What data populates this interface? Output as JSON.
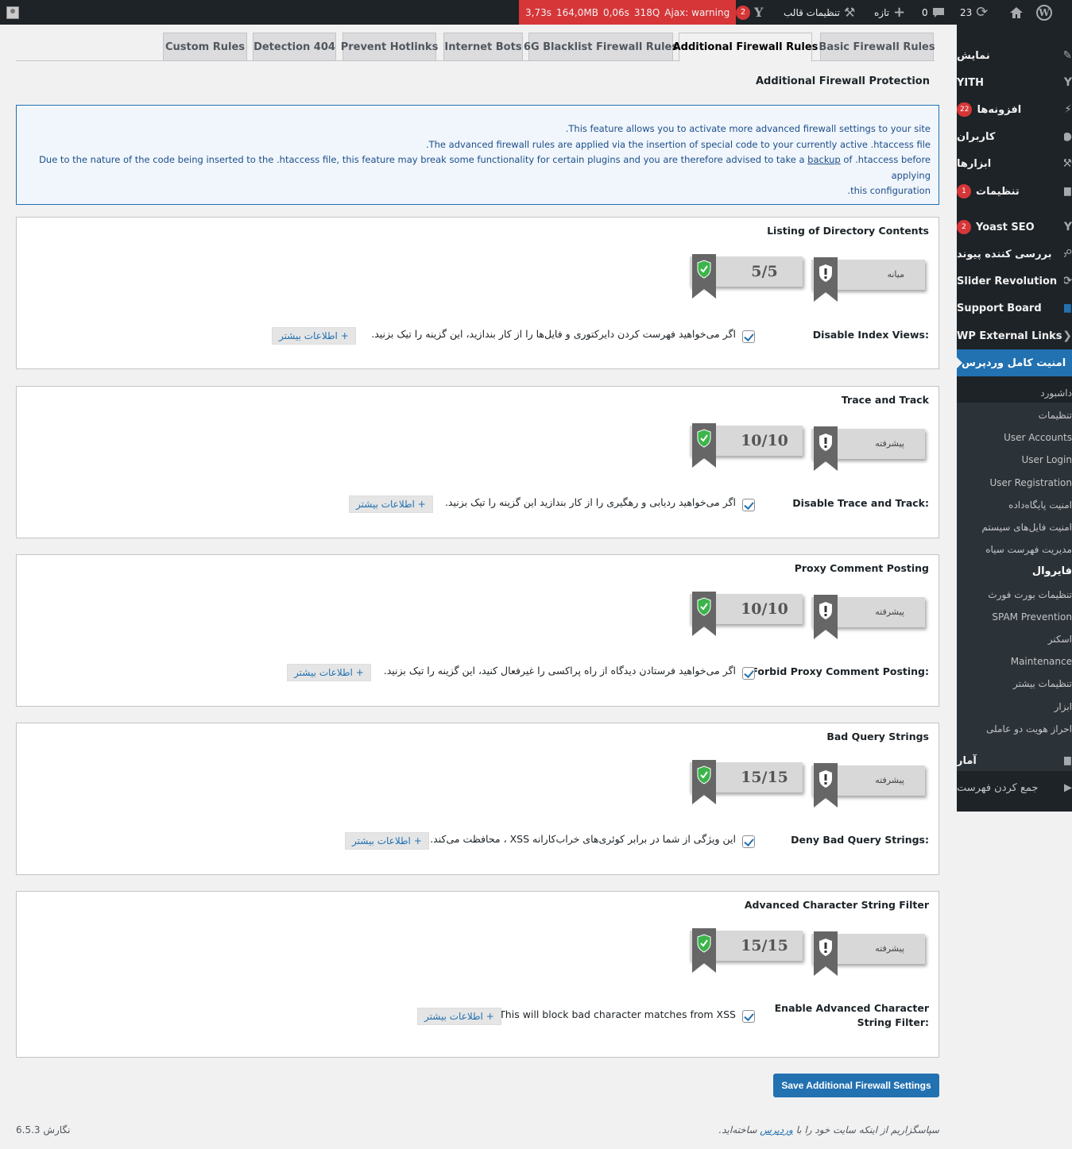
{
  "adminbar": {
    "avatar_icon": "avatar-icon",
    "debug": {
      "time": "3,73s",
      "memory": "164,0MB",
      "query_time": "0,06s",
      "queries": "318Q",
      "ajax": "Ajax: warning"
    },
    "yoast_count": "2",
    "theme_settings": "تنظیمات قالب",
    "new_label": "تازه",
    "comments_count": "0",
    "updates_count": "23"
  },
  "sidebar": {
    "items": [
      {
        "label": "نمایش",
        "icon": "appearance-icon"
      },
      {
        "label": "YITH",
        "icon": "yith-icon"
      },
      {
        "label": "افزونه‌ها",
        "icon": "plugins-icon",
        "badge": "22"
      },
      {
        "label": "کاربران",
        "icon": "users-icon"
      },
      {
        "label": "ابزارها",
        "icon": "tools-icon"
      },
      {
        "label": "تنظیمات",
        "icon": "settings-icon",
        "badge": "1"
      },
      {
        "label": "Yoast SEO",
        "icon": "yoast-icon",
        "badge": "2"
      },
      {
        "label": "بررسی کننده پیوند",
        "icon": "link-checker-icon"
      },
      {
        "label": "Slider Revolution",
        "icon": "slider-icon"
      },
      {
        "label": "Support Board",
        "icon": "support-icon"
      },
      {
        "label": "WP External Links",
        "icon": "external-links-icon"
      },
      {
        "label": "امنیت کامل وردپرس",
        "icon": "shield-icon"
      },
      {
        "label": "آمار",
        "icon": "stats-icon"
      },
      {
        "label": "جمع کردن فهرست",
        "icon": "collapse-icon"
      }
    ],
    "submenu": [
      "داشبورد",
      "تنظیمات",
      "User Accounts",
      "User Login",
      "User Registration",
      "امنیت پایگاه‌داده",
      "امنیت فایل‌های سیستم",
      "مدیریت فهرست سیاه",
      "فایروال",
      "تنظیمات بورت فورث",
      "SPAM Prevention",
      "اسکنر",
      "Maintenance",
      "تنظیمات بیشتر",
      "ابزار",
      "احراز هویت دو عاملی"
    ]
  },
  "tabs": [
    "Custom Rules",
    "Detection 404",
    "Prevent Hotlinks",
    "Internet Bots",
    "6G Blacklist Firewall Rules",
    "Additional Firewall Rules",
    "Basic Firewall Rules"
  ],
  "active_tab": "Additional Firewall Rules",
  "page_heading": "Additional Firewall Protection",
  "info": {
    "line1": ".This feature allows you to activate more advanced firewall settings to your site",
    "line2": ".The advanced firewall rules are applied via the insertion of special code to your currently active .htaccess file",
    "line3_pre": "Due to the nature of the code being inserted to the .htaccess file, this feature may break some functionality for certain plugins and you are therefore advised to take a",
    "line3_link": "backup",
    "line3_post": "of .htaccess before applying",
    "line4": ".this configuration"
  },
  "sections": [
    {
      "title": "Listing of Directory Contents",
      "level": "میانه",
      "score": "5/5",
      "field_label": "Disable Index Views:",
      "description": "اگر می‌خواهید فهرست کردن دایرکتوری و فایل‌ها را از کار بندازید، این گزینه را تیک بزنید.",
      "more": "+ اطلاعات بیشتر"
    },
    {
      "title": "Trace and Track",
      "level": "پیشرفته",
      "score": "10/10",
      "field_label": "Disable Trace and Track:",
      "description": "اگر می‌خواهید ردیابی و رهگیری را از کار بندازید این گزینه را تیک بزنید.",
      "more": "+ اطلاعات بیشتر"
    },
    {
      "title": "Proxy Comment Posting",
      "level": "پیشرفته",
      "score": "10/10",
      "field_label": "Forbid Proxy Comment Posting:",
      "description": "اگر می‌خواهید فرستادن دیدگاه از راه پراکسی را غیرفعال کنید، این گزینه را تیک بزنید.",
      "more": "+ اطلاعات بیشتر"
    },
    {
      "title": "Bad Query Strings",
      "level": "پیشرفته",
      "score": "15/15",
      "field_label": "Deny Bad Query Strings:",
      "description": "این ویژگی از شما در برابر کوئری‌های خراب‌کارانه XSS ، محافظت می‌کند.",
      "more": "+ اطلاعات بیشتر"
    },
    {
      "title": "Advanced Character String Filter",
      "level": "پیشرفته",
      "score": "15/15",
      "field_label_1": "Enable Advanced Character",
      "field_label_2": "String Filter:",
      "description": ".This will block bad character matches from XSS",
      "more": "+ اطلاعات بیشتر"
    }
  ],
  "save_button": "Save Additional Firewall Settings",
  "footer": {
    "thanks_pre": "سپاسگزاریم از اینکه سایت خود را با",
    "thanks_link": "وردپرس",
    "thanks_post": "ساخته‌اید.",
    "version": "نگارش 6.5.3"
  }
}
